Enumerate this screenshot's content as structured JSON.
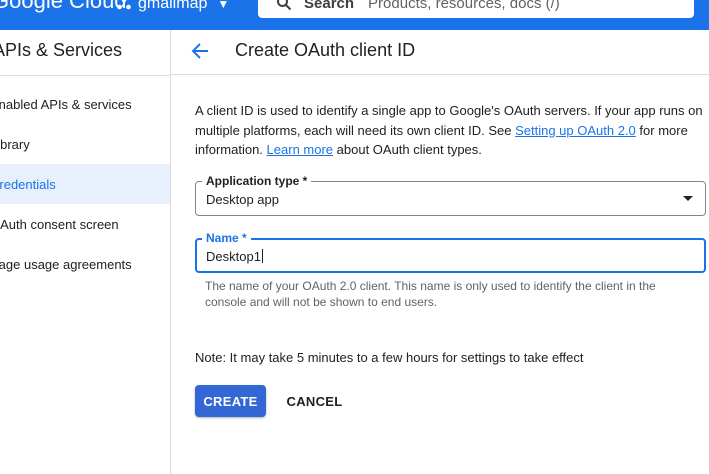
{
  "topbar": {
    "logo_text": "Google Cloud",
    "project_name": "gmailmap",
    "search": {
      "label": "Search",
      "placeholder": "Products, resources, docs (/)"
    },
    "colors": {
      "background": "#1a73e8"
    }
  },
  "sidebar": {
    "title": "APIs & Services",
    "items": [
      {
        "label": "Enabled APIs & services",
        "active": false
      },
      {
        "label": "Library",
        "active": false
      },
      {
        "label": "Credentials",
        "active": true
      },
      {
        "label": "OAuth consent screen",
        "active": false
      },
      {
        "label": "Page usage agreements",
        "active": false
      }
    ]
  },
  "main": {
    "page_title": "Create OAuth client ID",
    "intro": {
      "part1": "A client ID is used to identify a single app to Google's OAuth servers. If your app runs on multiple platforms, each will need its own client ID. See ",
      "link1": "Setting up OAuth 2.0",
      "part2": " for more information. ",
      "link2": "Learn more",
      "part3": " about OAuth client types."
    },
    "application_type": {
      "label": "Application type *",
      "value": "Desktop app"
    },
    "name_field": {
      "label": "Name *",
      "value": "Desktop1",
      "helper": "The name of your OAuth 2.0 client. This name is only used to identify the client in the console and will not be shown to end users."
    },
    "note": "Note: It may take 5 minutes to a few hours for settings to take effect",
    "buttons": {
      "create": "CREATE",
      "cancel": "CANCEL"
    }
  },
  "colors": {
    "accent": "#1a73e8",
    "primary_button": "#3367d6",
    "active_nav_bg": "#e8f0fe",
    "helper_text": "#5f6368"
  }
}
